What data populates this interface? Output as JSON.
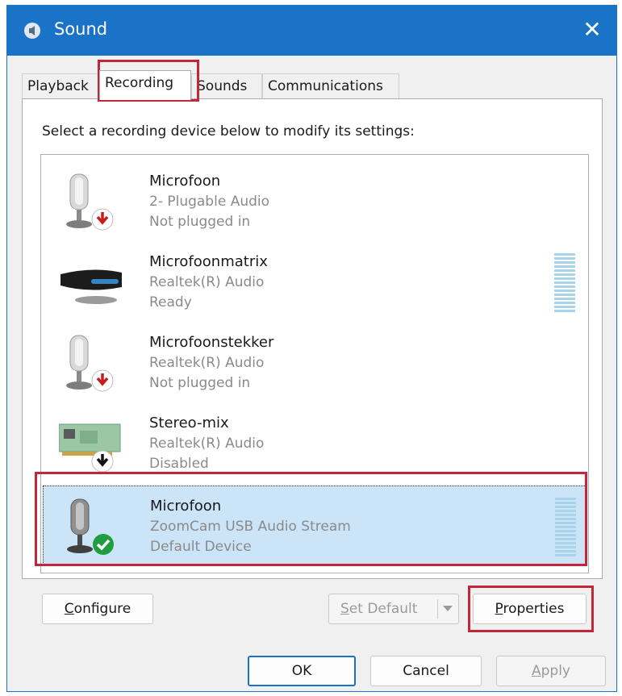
{
  "window": {
    "title": "Sound",
    "close_glyph": "✕"
  },
  "tabs": [
    {
      "label": "Playback",
      "active": false
    },
    {
      "label": "Recording",
      "active": true
    },
    {
      "label": "Sounds",
      "active": false
    },
    {
      "label": "Communications",
      "active": false
    }
  ],
  "instruction": "Select a recording device below to modify its settings:",
  "devices": [
    {
      "name": "Microfoon",
      "line1": "2- Plugable Audio",
      "line2": "Not plugged in",
      "icon": "microphone-icon",
      "status_icon": "red-down-arrow-icon",
      "selected": false,
      "has_meter": false
    },
    {
      "name": "Microfoonmatrix",
      "line1": "Realtek(R) Audio",
      "line2": "Ready",
      "icon": "microphone-array-icon",
      "status_icon": "",
      "selected": false,
      "has_meter": true
    },
    {
      "name": "Microfoonstekker",
      "line1": "Realtek(R) Audio",
      "line2": "Not plugged in",
      "icon": "microphone-icon",
      "status_icon": "red-down-arrow-icon",
      "selected": false,
      "has_meter": false
    },
    {
      "name": "Stereo-mix",
      "line1": "Realtek(R) Audio",
      "line2": "Disabled",
      "icon": "sound-card-icon",
      "status_icon": "black-down-arrow-icon",
      "selected": false,
      "has_meter": false
    },
    {
      "name": "Microfoon",
      "line1": "ZoomCam USB Audio Stream",
      "line2": "Default Device",
      "icon": "microphone-icon",
      "status_icon": "green-check-icon",
      "selected": true,
      "has_meter": true
    }
  ],
  "buttons": {
    "configure_prefix": "",
    "configure_mnemonic": "C",
    "configure_rest": "onfigure",
    "set_default_mnemonic": "S",
    "set_default_rest": "et Default",
    "properties_mnemonic": "P",
    "properties_rest": "roperties",
    "ok": "OK",
    "cancel": "Cancel",
    "apply_mnemonic": "A",
    "apply_rest": "pply"
  },
  "colors": {
    "accent": "#1a73c7",
    "highlight": "#c0283a",
    "selection": "#cce4f7"
  }
}
